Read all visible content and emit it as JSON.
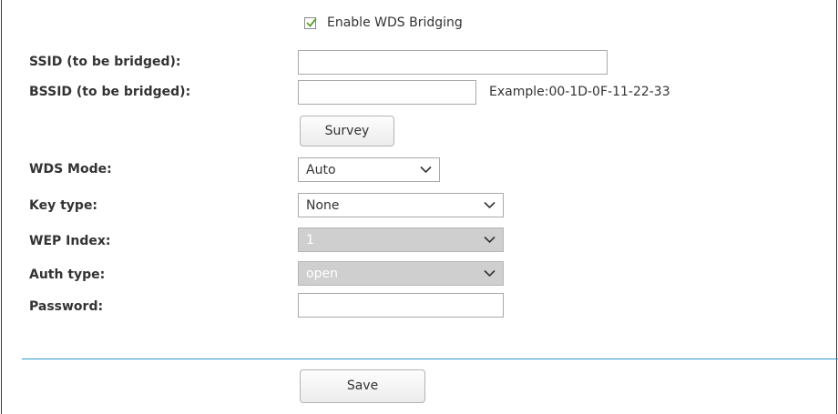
{
  "wds": {
    "enable_label": "Enable WDS Bridging",
    "enable_checked": true
  },
  "ssid": {
    "label": "SSID (to be bridged):",
    "value": ""
  },
  "bssid": {
    "label": "BSSID (to be bridged):",
    "value": "",
    "example": "Example:00-1D-0F-11-22-33"
  },
  "survey": {
    "label": "Survey"
  },
  "wds_mode": {
    "label": "WDS Mode:",
    "value": "Auto"
  },
  "key_type": {
    "label": "Key type:",
    "value": "None"
  },
  "wep_index": {
    "label": "WEP Index:",
    "value": "1",
    "disabled": true
  },
  "auth_type": {
    "label": "Auth type:",
    "value": "open",
    "disabled": true
  },
  "password": {
    "label": "Password:",
    "value": ""
  },
  "save": {
    "label": "Save"
  },
  "colors": {
    "accent_divider": "#2d9ac9",
    "checkmark": "#5aa02c",
    "disabled_bg": "#cfcfcf"
  }
}
